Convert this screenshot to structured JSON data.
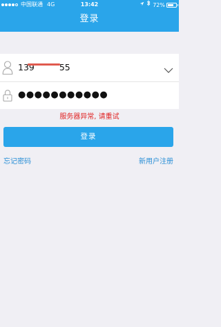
{
  "status_bar": {
    "carrier": "中国联通",
    "network": "4G",
    "time": "13:42",
    "battery_percent": "72%",
    "battery_level": 0.72,
    "location_icon": "location-arrow-icon",
    "bluetooth_icon": "bluetooth-icon"
  },
  "header": {
    "title": "登录"
  },
  "form": {
    "phone": {
      "visible_prefix": "139",
      "visible_suffix": "55",
      "redacted": true,
      "icon": "user-icon",
      "dropdown_icon": "chevron-down-icon"
    },
    "password": {
      "masked_value": "●●●●●●●●●●●",
      "icon": "lock-icon"
    }
  },
  "error_message": "服务器异常, 请重试",
  "login_button": "登录",
  "links": {
    "forgot_password": "忘记密码",
    "register": "新用户注册"
  },
  "colors": {
    "primary": "#2aa5ea",
    "error": "#e02424",
    "link": "#2a8fd6",
    "background": "#f0eff4"
  }
}
